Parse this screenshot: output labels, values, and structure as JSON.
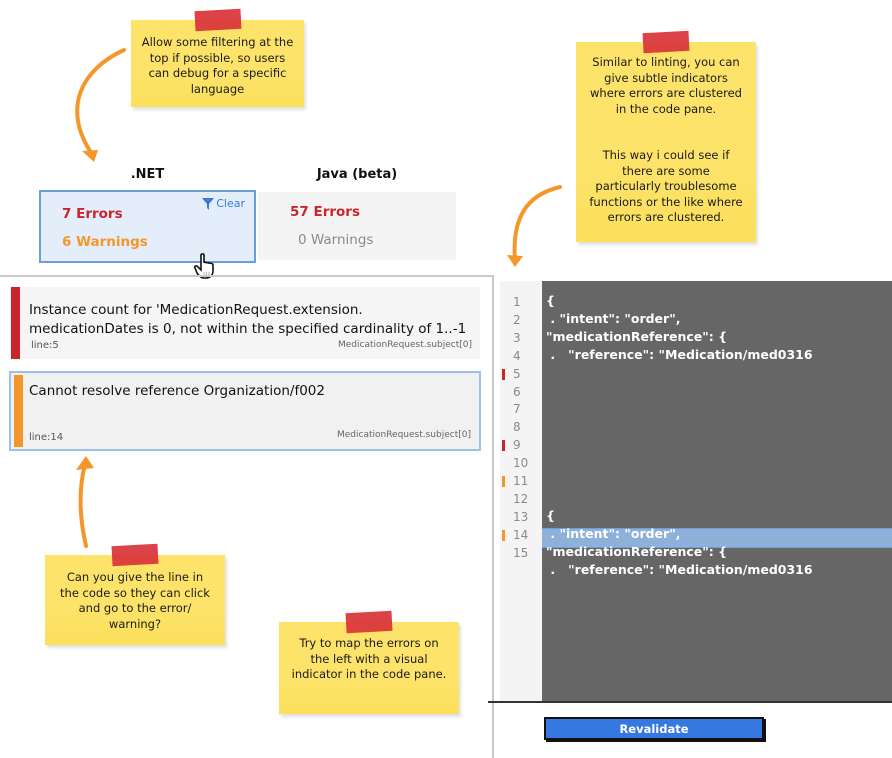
{
  "notes": {
    "filter": "Allow some filtering at the\ntop if possible, so users\ncan debug for a specific\nlanguage",
    "lint": "Similar to linting, you can\ngive subtle indicators\nwhere errors are clustered\nin the code pane.\n\n\nThis way i could see if\nthere are some\nparticularly troublesome\nfunctions or the like where\nerrors are clustered.",
    "line": "Can you give the line in\nthe code so they can click\nand go to the error/\nwarning?",
    "map": "Try to map the errors on\nthe left with a visual\nindicator in the code pane."
  },
  "languages": [
    {
      "name": ".NET",
      "errors": "7 Errors",
      "warnings": "6 Warnings",
      "filter_label": "Clear",
      "selected": true
    },
    {
      "name": "Java (beta)",
      "errors": "57 Errors",
      "warnings": "0 Warnings",
      "selected": false
    }
  ],
  "issues": [
    {
      "severity": "error",
      "message": "Instance count for 'MedicationRequest.extension.\nmedicationDates is 0, not within the specified cardinality of 1..-1",
      "line": "line:5",
      "path": "MedicationRequest.subject[0]"
    },
    {
      "severity": "warning",
      "message": "Cannot resolve reference Organization/f002",
      "line": "line:14",
      "path": "MedicationRequest.subject[0]"
    }
  ],
  "code": {
    "line_numbers": [
      "1",
      "2",
      "3",
      "4",
      "5",
      "6",
      "7",
      "8",
      "9",
      "10",
      "11",
      "12",
      "13",
      "14",
      "15"
    ],
    "markers": {
      "5": "error",
      "9": "error",
      "11": "warning",
      "14": "warning"
    },
    "lines": [
      "{",
      " . \"intent\": \"order\",",
      "\"medicationReference\": {",
      " .   \"reference\": \"Medication/med0316",
      "{",
      " . \"intent\": \"order\",",
      "\"medicationReference\": {",
      " .   \"reference\": \"Medication/med0316"
    ],
    "highlighted_line": "14"
  },
  "colors": {
    "error": "#c9252c",
    "warning": "#f5962a",
    "accent": "#3578e0",
    "note": "#fde36a"
  },
  "actions": {
    "revalidate": "Revalidate"
  }
}
